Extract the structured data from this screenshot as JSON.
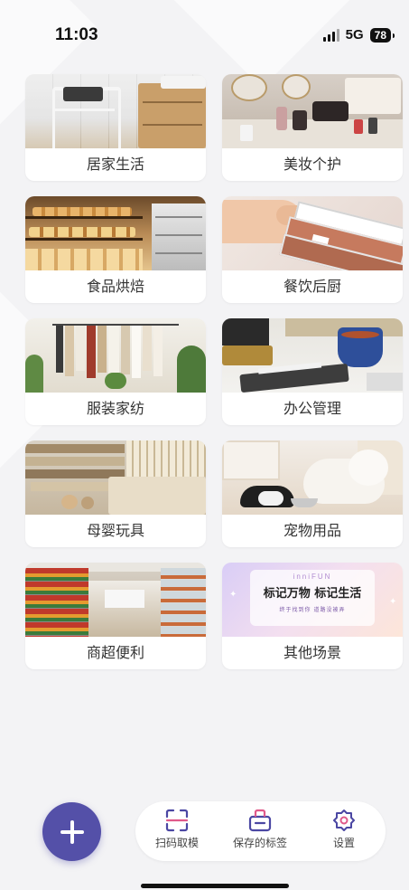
{
  "status": {
    "time": "11:03",
    "network": "5G",
    "battery": "78"
  },
  "categories": [
    {
      "label": "居家生活",
      "icon": "home-living-photo"
    },
    {
      "label": "美妆个护",
      "icon": "beauty-care-photo"
    },
    {
      "label": "食品烘焙",
      "icon": "food-bakery-photo"
    },
    {
      "label": "餐饮后厨",
      "icon": "kitchen-photo"
    },
    {
      "label": "服装家纺",
      "icon": "clothing-textile-photo"
    },
    {
      "label": "办公管理",
      "icon": "office-photo"
    },
    {
      "label": "母婴玩具",
      "icon": "baby-toys-photo"
    },
    {
      "label": "宠物用品",
      "icon": "pet-supplies-photo"
    },
    {
      "label": "商超便利",
      "icon": "supermarket-photo"
    },
    {
      "label": "其他场景",
      "icon": "other-scenes-promo"
    }
  ],
  "promo": {
    "brand": "inniFUN",
    "slogan": "标记万物 标记生活",
    "sub": "终于找到你  道路没被弄"
  },
  "tabbar": {
    "items": [
      {
        "label": "扫码取模",
        "icon": "scan-icon"
      },
      {
        "label": "保存的标签",
        "icon": "saved-label-icon"
      },
      {
        "label": "设置",
        "icon": "settings-icon"
      }
    ]
  },
  "colors": {
    "accent": "#5450a8",
    "background": "#f3f3f5",
    "tab_icon": "#4b47a3"
  }
}
